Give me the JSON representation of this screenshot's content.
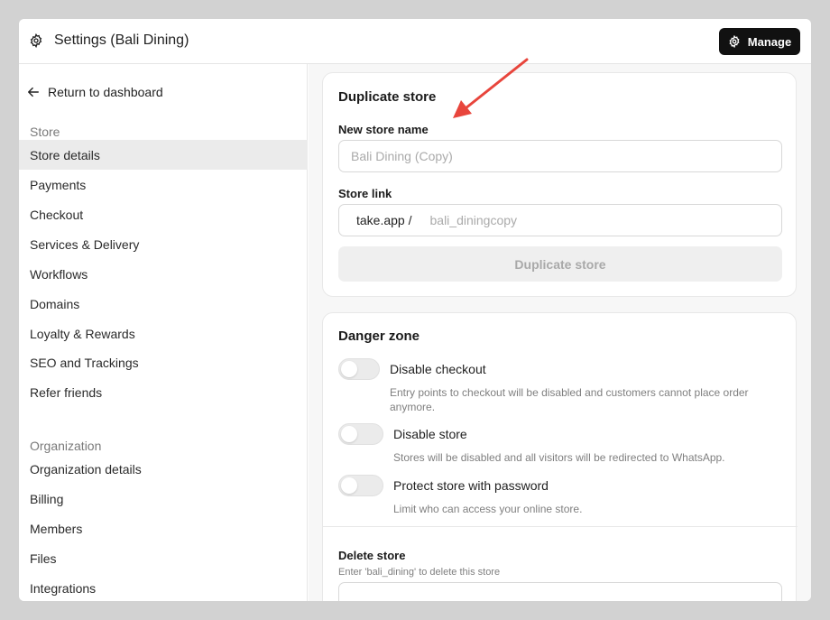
{
  "header": {
    "title": "Settings (Bali Dining)",
    "manage_label": "Manage"
  },
  "sidebar": {
    "back_label": "Return to dashboard",
    "store_section": "Store",
    "store_items": [
      "Store details",
      "Payments",
      "Checkout",
      "Services & Delivery",
      "Workflows",
      "Domains",
      "Loyalty & Rewards",
      "SEO and Trackings",
      "Refer friends"
    ],
    "org_section": "Organization",
    "org_items": [
      "Organization details",
      "Billing",
      "Members",
      "Files",
      "Integrations"
    ]
  },
  "duplicate": {
    "title": "Duplicate store",
    "name_label": "New store name",
    "name_placeholder": "Bali Dining (Copy)",
    "link_label": "Store link",
    "link_prefix": "take.app /",
    "link_placeholder": "bali_diningcopy",
    "button_label": "Duplicate store"
  },
  "danger": {
    "title": "Danger zone",
    "toggles": [
      {
        "label": "Disable checkout",
        "desc_line1": "Entry points to checkout will be disabled and customers cannot place order",
        "desc_line2": "anymore."
      },
      {
        "label": "Disable store",
        "desc_line1": "Stores will be disabled and all visitors will be redirected to WhatsApp."
      },
      {
        "label": "Protect store with password",
        "desc_line1": "Limit who can access your online store."
      }
    ],
    "delete_label": "Delete store",
    "delete_desc": "Enter 'bali_dining' to delete this store"
  },
  "colors": {
    "annotation_arrow": "#e8453c",
    "manage_bg": "#111111"
  }
}
